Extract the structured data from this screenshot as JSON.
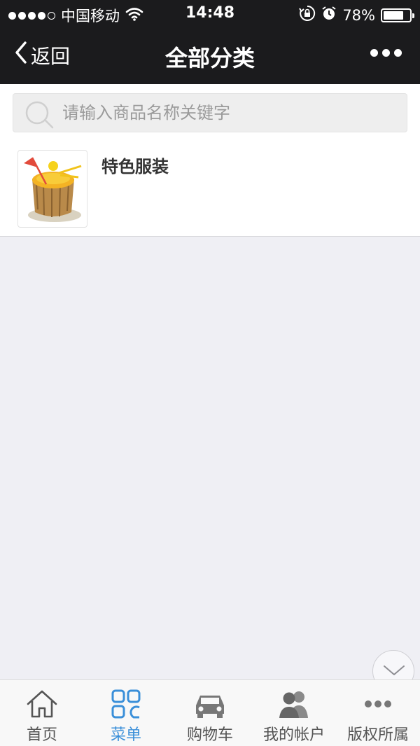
{
  "status_bar": {
    "carrier": "中国移动",
    "time": "14:48",
    "battery_percent": "78%",
    "battery_level": 0.78
  },
  "nav": {
    "back_label": "返回",
    "title": "全部分类",
    "more_icon": "more-icon"
  },
  "search": {
    "placeholder": "请输入商品名称关键字",
    "value": ""
  },
  "categories": [
    {
      "name": "特色服装",
      "thumb_icon": "coconut-drink-image"
    }
  ],
  "tabbar": {
    "active_index": 1,
    "active_color": "#3a8fd9",
    "items": [
      {
        "label": "首页",
        "icon": "home-icon"
      },
      {
        "label": "菜单",
        "icon": "menu-grid-icon"
      },
      {
        "label": "购物车",
        "icon": "car-icon"
      },
      {
        "label": "我的帐户",
        "icon": "users-icon"
      },
      {
        "label": "版权所属",
        "icon": "more-dots-icon"
      }
    ]
  }
}
